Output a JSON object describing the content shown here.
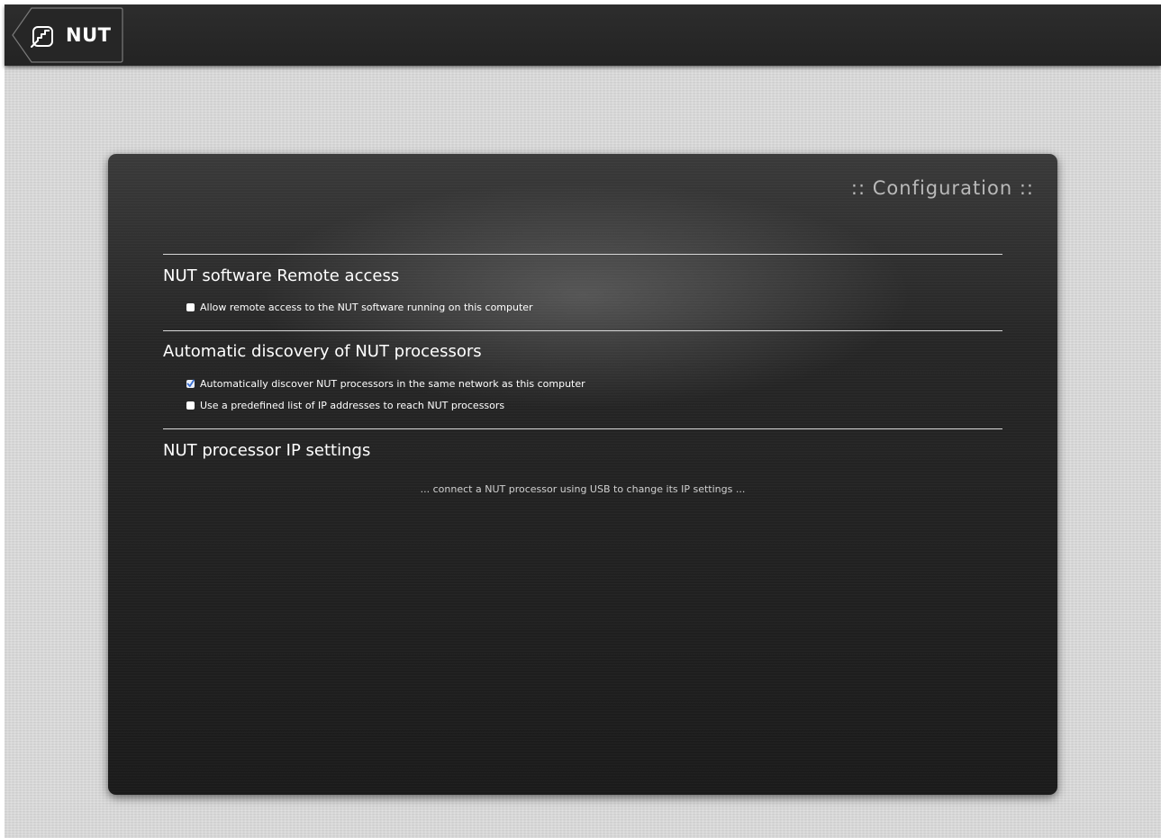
{
  "header": {
    "back_label": "NUT",
    "back_icon": "nut-logo-icon"
  },
  "panel": {
    "title": ":: Configuration ::",
    "sections": [
      {
        "heading": "NUT software Remote access",
        "options": [
          {
            "label": "Allow remote access to the NUT software running on this computer",
            "checked": false
          }
        ]
      },
      {
        "heading": "Automatic discovery of NUT processors",
        "options": [
          {
            "label": "Automatically discover NUT processors in the same network as this computer",
            "checked": true
          },
          {
            "label": "Use a predefined list of IP addresses to reach NUT processors",
            "checked": false
          }
        ]
      },
      {
        "heading": "NUT processor IP settings",
        "info": "... connect a NUT processor using USB to change its IP settings ..."
      }
    ]
  },
  "colors": {
    "topbar": "#2a2a2a",
    "panel": "#222222",
    "background": "#d6d6d6",
    "checkbox_check": "#3a6fd1"
  }
}
